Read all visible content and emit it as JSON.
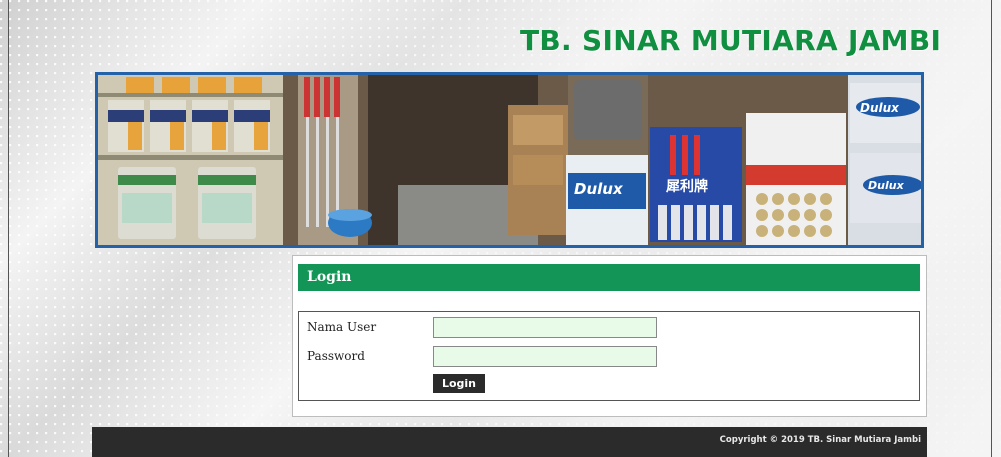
{
  "site": {
    "title": "TB. SINAR MUTIARA JAMBI"
  },
  "login": {
    "heading": "Login",
    "username_label": "Nama User",
    "username_value": "",
    "password_label": "Password",
    "password_value": "",
    "submit_label": "Login"
  },
  "footer": {
    "copyright": "Copyright © 2019 TB. Sinar Mutiara Jambi"
  },
  "colors": {
    "title_green": "#0f8f3f",
    "header_green": "#139557",
    "banner_border": "#2362a8",
    "input_bg": "#e8fbe8",
    "footer_bg": "#2b2b2b"
  },
  "banner": {
    "image_subject": "paint store interior with paint cans on shelves",
    "brand_text": "Dulux",
    "sign_text": "犀利牌"
  }
}
